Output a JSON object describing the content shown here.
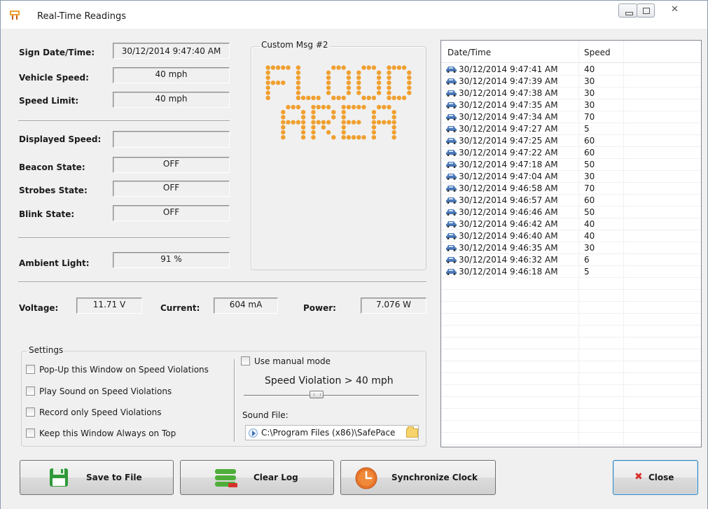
{
  "window": {
    "title": "Real-Time Readings"
  },
  "fields": {
    "sign_datetime": {
      "label": "Sign Date/Time:",
      "value": "30/12/2014 9:47:40 AM"
    },
    "vehicle_speed": {
      "label": "Vehicle Speed:",
      "value": "40 mph"
    },
    "speed_limit": {
      "label": "Speed Limit:",
      "value": "40 mph"
    },
    "displayed_speed": {
      "label": "Displayed Speed:",
      "value": ""
    },
    "beacon_state": {
      "label": "Beacon State:",
      "value": "OFF"
    },
    "strobes_state": {
      "label": "Strobes State:",
      "value": "OFF"
    },
    "blink_state": {
      "label": "Blink State:",
      "value": "OFF"
    },
    "ambient_light": {
      "label": "Ambient Light:",
      "value": "91 %"
    },
    "voltage": {
      "label": "Voltage:",
      "value": "11.71 V"
    },
    "current": {
      "label": "Current:",
      "value": "604 mA"
    },
    "power": {
      "label": "Power:",
      "value": "7.076 W"
    }
  },
  "message": {
    "caption": "Custom Msg #2",
    "lines": [
      "FLOOD",
      "AREA"
    ],
    "led_color": "#f0a030"
  },
  "settings": {
    "caption": "Settings",
    "popup": "Pop-Up this Window on Speed Violations",
    "play_sound": "Play Sound on Speed Violations",
    "record_only": "Record only Speed Violations",
    "always_on_top": "Keep this Window Always on Top",
    "manual_mode": "Use manual mode",
    "speed_violation": "Speed Violation > 40 mph",
    "slider_level": 0.4,
    "sound_file_label": "Sound File:",
    "sound_file_path": "C:\\Program Files (x86)\\SafePace"
  },
  "log": {
    "columns": [
      "Date/Time",
      "Speed"
    ],
    "rows": [
      {
        "datetime": "30/12/2014 9:47:41 AM",
        "speed": "40"
      },
      {
        "datetime": "30/12/2014 9:47:39 AM",
        "speed": "30"
      },
      {
        "datetime": "30/12/2014 9:47:38 AM",
        "speed": "30"
      },
      {
        "datetime": "30/12/2014 9:47:35 AM",
        "speed": "30"
      },
      {
        "datetime": "30/12/2014 9:47:34 AM",
        "speed": "70"
      },
      {
        "datetime": "30/12/2014 9:47:27 AM",
        "speed": "5"
      },
      {
        "datetime": "30/12/2014 9:47:25 AM",
        "speed": "60"
      },
      {
        "datetime": "30/12/2014 9:47:22 AM",
        "speed": "60"
      },
      {
        "datetime": "30/12/2014 9:47:18 AM",
        "speed": "50"
      },
      {
        "datetime": "30/12/2014 9:47:04 AM",
        "speed": "30"
      },
      {
        "datetime": "30/12/2014 9:46:58 AM",
        "speed": "70"
      },
      {
        "datetime": "30/12/2014 9:46:57 AM",
        "speed": "60"
      },
      {
        "datetime": "30/12/2014 9:46:46 AM",
        "speed": "50"
      },
      {
        "datetime": "30/12/2014 9:46:42 AM",
        "speed": "40"
      },
      {
        "datetime": "30/12/2014 9:46:40 AM",
        "speed": "40"
      },
      {
        "datetime": "30/12/2014 9:46:35 AM",
        "speed": "30"
      },
      {
        "datetime": "30/12/2014 9:46:32 AM",
        "speed": "6"
      },
      {
        "datetime": "30/12/2014 9:46:18 AM",
        "speed": "5"
      }
    ]
  },
  "buttons": {
    "save": "Save to File",
    "clear": "Clear Log",
    "sync": "Synchronize Clock",
    "close": "Close"
  },
  "colors": {
    "close_accent": "#d9302b",
    "save_accent": "#2f9a3a",
    "clock_accent": "#e7762b"
  }
}
